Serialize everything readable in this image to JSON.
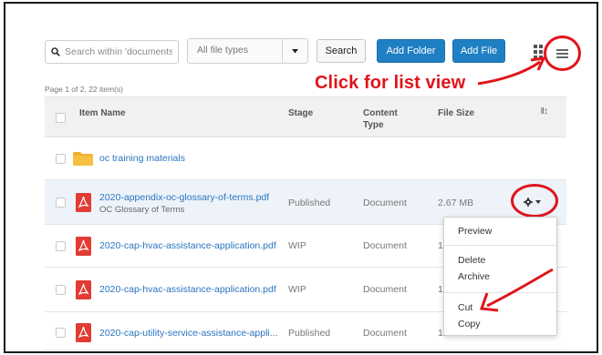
{
  "toolbar": {
    "search_placeholder": "Search within 'documents",
    "file_type_value": "All file types",
    "search_label": "Search",
    "add_folder_label": "Add Folder",
    "add_file_label": "Add File",
    "accent": "#1f7fc3"
  },
  "annotations": {
    "list_view_callout": "Click for list view",
    "color": "#e0141b"
  },
  "page_info": "Page 1 of 2, 22 item(s)",
  "columns": {
    "item_name": "Item Name",
    "stage": "Stage",
    "content_type_line1": "Content",
    "content_type_line2": "Type",
    "file_size": "File Size"
  },
  "rows": [
    {
      "type": "folder",
      "name": "oc training materials"
    },
    {
      "type": "pdf",
      "name": "2020-appendix-oc-glossary-of-terms.pdf",
      "subtitle": "OC Glossary of Terms",
      "stage": "Published",
      "content_type": "Document",
      "file_size": "2.67 MB"
    },
    {
      "type": "pdf",
      "name": "2020-cap-hvac-assistance-application.pdf",
      "stage": "WIP",
      "content_type": "Document",
      "file_size": "1."
    },
    {
      "type": "pdf",
      "name": "2020-cap-hvac-assistance-application.pdf",
      "stage": "WIP",
      "content_type": "Document",
      "file_size": "1."
    },
    {
      "type": "pdf",
      "name": "2020-cap-utility-service-assistance-appli...",
      "stage": "Published",
      "content_type": "Document",
      "file_size": "1."
    }
  ],
  "action_menu": {
    "preview": "Preview",
    "delete": "Delete",
    "archive": "Archive",
    "cut": "Cut",
    "copy": "Copy"
  },
  "icons": [
    "search-icon",
    "chevron-down-icon",
    "grid-view-icon",
    "list-view-icon",
    "folder-icon",
    "pdf-icon",
    "gear-icon",
    "sort-columns-icon"
  ]
}
